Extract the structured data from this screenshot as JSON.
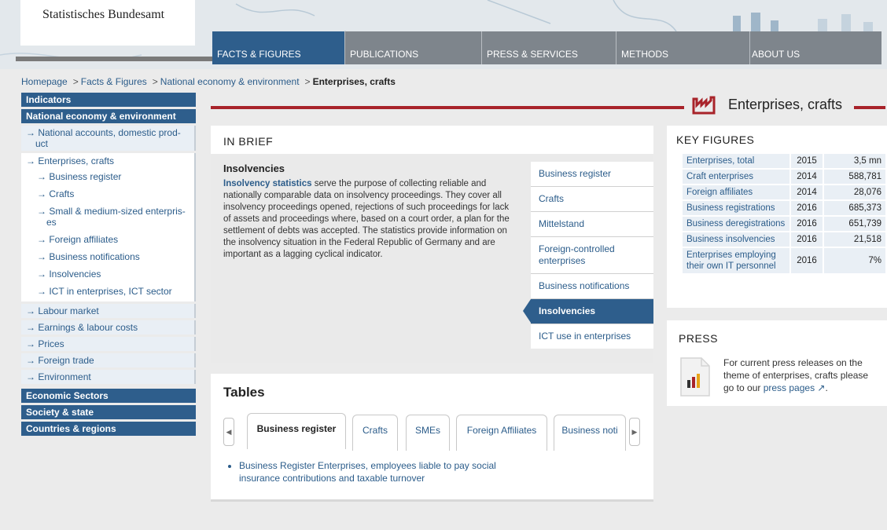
{
  "header": {
    "logo_text": "Statistisches Bundesamt",
    "nav": [
      {
        "label": "FACTS & FIGURES",
        "active": true
      },
      {
        "label": "PUBLICATIONS"
      },
      {
        "label": "PRESS & SERVICES"
      },
      {
        "label": "METHODS"
      },
      {
        "label": "ABOUT US"
      }
    ]
  },
  "breadcrumb": {
    "items": [
      "Homepage",
      "Facts & Figures",
      "National economy & environment"
    ],
    "current": "Enterprises, crafts"
  },
  "sidebar": {
    "indicators": "Indicators",
    "national_economy": "National economy & environment",
    "national_accounts": "National accounts, domestic prod-uct",
    "enterprises": "Enterprises, crafts",
    "sub_items": [
      "Business register",
      "Crafts",
      "Small & medium-sized enterpris-es",
      "Foreign affiliates",
      "Business notifications",
      "Insolvencies",
      "ICT in enterprises, ICT sector"
    ],
    "more_items": [
      "Labour market",
      "Earnings & labour costs",
      "Prices",
      "Foreign trade",
      "Environment"
    ],
    "sections": [
      "Economic Sectors",
      "Society & state",
      "Countries & regions"
    ]
  },
  "page_title": "Enterprises, crafts",
  "in_brief": {
    "heading": "IN BRIEF",
    "title": "Insolvencies",
    "link_text": "Insolvency statistics",
    "text": " serve the purpose of collecting reliable and nationally comparable data on insolvency proceedings. They cover all insolvency proceedings opened, rejections of such proceedings for lack of assets and proceedings where, based on a court order, a plan for the settlement of debts was accepted. The statistics provide information on the insolvency situation in the Federal Republic of Germany and are important as a lagging cyclical indicator.",
    "topics": [
      "Business register",
      "Crafts",
      "Mittelstand",
      "Foreign-controlled enterprises",
      "Business notifications",
      "Insolvencies",
      "ICT use in enterprises"
    ],
    "active_topic": "Insolvencies"
  },
  "tables": {
    "heading": "Tables",
    "tabs": [
      "Business register",
      "Crafts",
      "SMEs",
      "Foreign Affiliates",
      "Business noti"
    ],
    "active_tab": "Business register",
    "items": [
      "Business Register Enterprises, employees liable to pay social insurance contributions and taxable turnover"
    ]
  },
  "key_figures": {
    "heading": "KEY FIGURES",
    "rows": [
      {
        "label": "Enterprises, total",
        "year": "2015",
        "value": "3,5 mn"
      },
      {
        "label": "Craft enterprises",
        "year": "2014",
        "value": "588,781"
      },
      {
        "label": "Foreign affiliates",
        "year": "2014",
        "value": "28,076"
      },
      {
        "label": "Business registrations",
        "year": "2016",
        "value": "685,373"
      },
      {
        "label": "Business deregistrations",
        "year": "2016",
        "value": "651,739"
      },
      {
        "label": "Business insolvencies",
        "year": "2016",
        "value": "21,518"
      },
      {
        "label": "Enterprises employing their own IT personnel",
        "year": "2016",
        "value": "7%"
      }
    ]
  },
  "press": {
    "heading": "PRESS",
    "text_before": "For current press releases on the theme of enterprises, crafts please go to our ",
    "link_text": "press pages",
    "text_after": "."
  },
  "colors": {
    "primary": "#2e5e8c",
    "accent_red": "#a8232a",
    "nav_grey": "#7e858c"
  }
}
